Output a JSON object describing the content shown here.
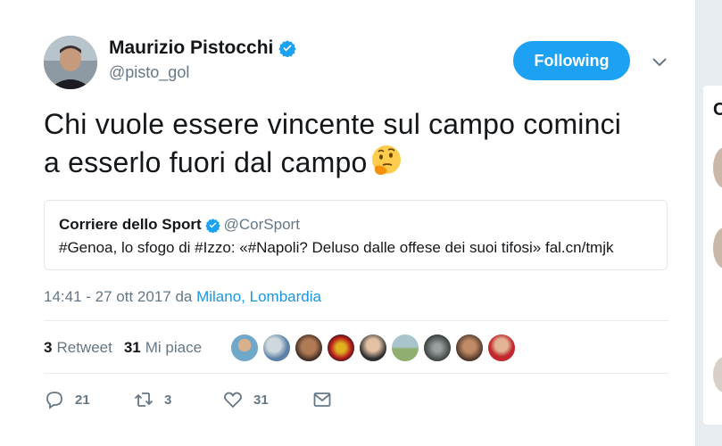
{
  "author": {
    "name": "Maurizio Pistocchi",
    "handle": "@pisto_gol"
  },
  "follow_button": {
    "label": "Following"
  },
  "tweet": {
    "text_line1": "Chi vuole essere vincente sul campo cominci",
    "text_line2": "a esserlo fuori dal campo"
  },
  "quote": {
    "name": "Corriere dello Sport",
    "handle": "@CorSport",
    "text": "#Genoa, lo sfogo di #Izzo: «#Napoli? Deluso dalle offese dei suoi tifosi» fal.cn/tmjk"
  },
  "meta": {
    "time": "14:41 - 27 ott 2017 da ",
    "location": "Milano, Lombardia"
  },
  "stats": {
    "retweet_count": "3",
    "retweet_label": "Retweet",
    "like_count": "31",
    "like_label": "Mi piace"
  },
  "actions": {
    "reply_count": "21",
    "retweet_count": "3",
    "like_count": "31"
  },
  "colors": {
    "accent": "#1da1f2",
    "link": "#1b95e0",
    "muted": "#657786"
  }
}
